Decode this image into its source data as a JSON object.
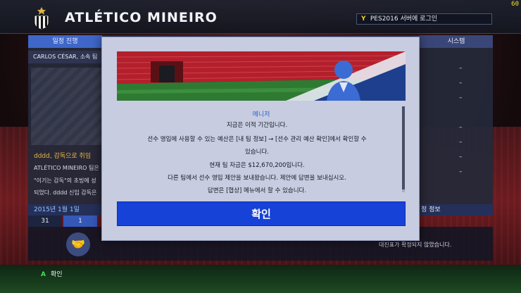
{
  "header": {
    "club_name": "ATLÉTICO MINEIRO",
    "login_button_glyph": "Y",
    "login_text": "PES2016 서버에 로그인",
    "fps": "60"
  },
  "background": {
    "tab_left": "일정 진행",
    "tab_right": "시스템",
    "coach_line": "CARLOS CÉSAR, 소속 팀",
    "news_title": "dddd, 감독으로 취임",
    "news_lines": [
      "ATLÉTICO MINEIRO 팀은",
      "\"이기는 감독\"의 초빙에 성",
      "되었다. dddd 신임 감독은"
    ],
    "date": "2015년 1월 1일",
    "days": [
      "31",
      "1"
    ],
    "right_dashes": [
      "–",
      "–",
      "–",
      "–",
      "–",
      "–",
      "–"
    ],
    "right_info": "정 정보",
    "right_note": "대진표가 확정되지 않았습니다."
  },
  "footer": {
    "button_glyph": "A",
    "label": "확인"
  },
  "dialog": {
    "tag": "메니저",
    "lines": [
      "지금은 이적 기간입니다.",
      "선수 영입에 사용할 수 있는 예산은 [내 팀 정보] → [선수 관리 예산 확인]에서 확인할 수",
      "있습니다.",
      "현재 팀 자금은 $12,670,200입니다.",
      "다른 팀에서 선수 영입 제안을 보내왔습니다. 제안에 답변을 보내십시오.",
      "답변은 [협상] 메뉴에서 할 수 있습니다."
    ],
    "confirm_label": "확인"
  },
  "colors": {
    "dialog_bg": "#c7cce0",
    "confirm_btn": "#1742d8",
    "tag_blue": "#2e63c8",
    "login_y": "#f5d21d",
    "a_button": "#3ee15a"
  }
}
